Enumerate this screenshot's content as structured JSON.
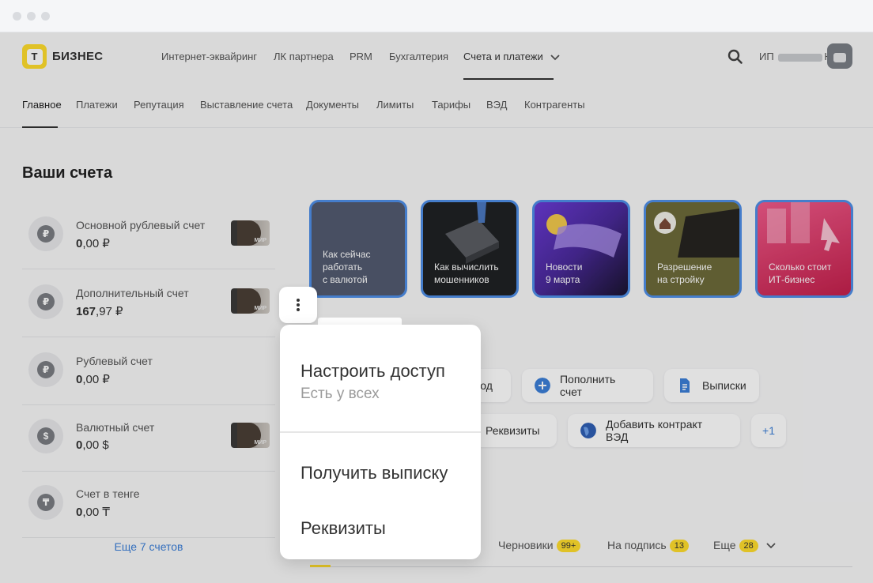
{
  "topnav": {
    "brand": "БИЗНЕС",
    "logo_letter": "Т",
    "items": [
      "Интернет-эквайринг",
      "ЛК партнера",
      "PRM",
      "Бухгалтерия",
      "Счета и платежи"
    ],
    "user_prefix": "ИП",
    "user_suffix": "Н."
  },
  "subnav": {
    "items": [
      "Главное",
      "Платежи",
      "Репутация",
      "Выставление счета",
      "Документы",
      "Лимиты",
      "Тарифы",
      "ВЭД",
      "Контрагенты"
    ]
  },
  "accounts": {
    "title": "Ваши счета",
    "items": [
      {
        "name": "Основной рублевый счет",
        "int": "0",
        "frac": ",00 ₽",
        "icon": "₽"
      },
      {
        "name": "Дополнительный счет",
        "int": "167",
        "frac": ",97 ₽",
        "icon": "₽"
      },
      {
        "name": "Рублевый счет",
        "int": "0",
        "frac": ",00 ₽",
        "icon": "₽"
      },
      {
        "name": "Валютный счет",
        "int": "0",
        "frac": ",00 $",
        "icon": "$"
      },
      {
        "name": "Счет в тенге",
        "int": "0",
        "frac": ",00 ₸",
        "icon": "₸"
      }
    ],
    "card_label": "МИР",
    "more": "Еще 7 счетов"
  },
  "stories": [
    {
      "l1": "Как сейчас",
      "l2": "работать",
      "l3": "с валютой"
    },
    {
      "l1": "Как вычислить",
      "l2": "мошенников",
      "l3": ""
    },
    {
      "l1": "Новости",
      "l2": "9 марта",
      "l3": ""
    },
    {
      "l1": "Разрешение",
      "l2": "на стройку",
      "l3": ""
    },
    {
      "l1": "Сколько стоит",
      "l2": "ИТ-бизнес",
      "l3": ""
    }
  ],
  "actions": {
    "transfer_partial": "вод",
    "topup": "Пополнить счет",
    "statements": "Выписки",
    "requisites": "Реквизиты",
    "add_contract": "Добавить контракт ВЭД",
    "more": "+1"
  },
  "tabs": {
    "drafts": "Черновики",
    "drafts_count": "99+",
    "to_sign": "На подпись",
    "to_sign_count": "13",
    "more": "Еще",
    "more_count": "28"
  },
  "menu": {
    "access": "Настроить доступ",
    "access_sub": "Есть у всех",
    "statement": "Получить выписку",
    "requisites": "Реквизиты"
  }
}
